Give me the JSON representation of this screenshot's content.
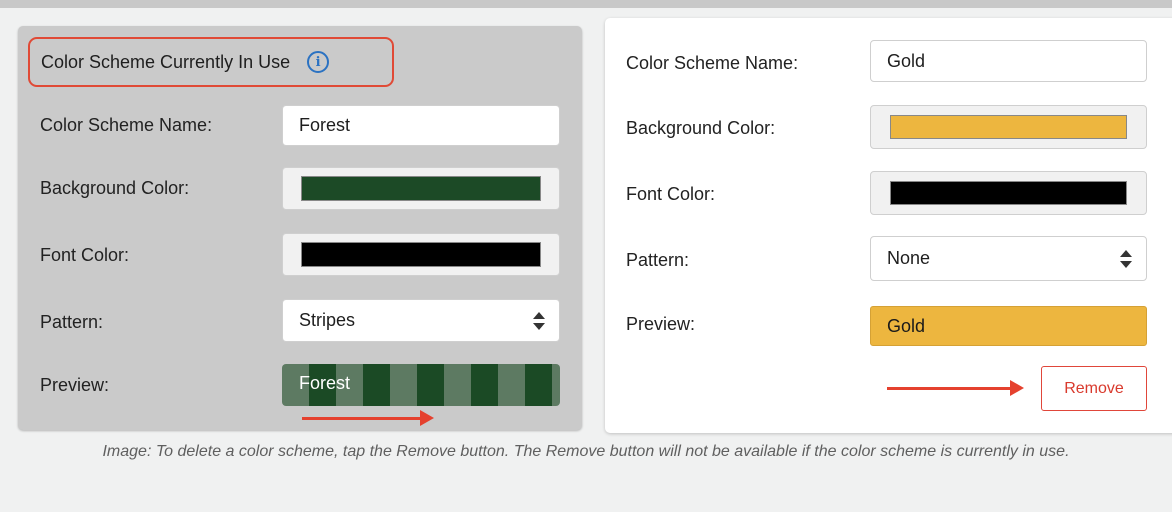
{
  "current_scheme": {
    "heading": "Color Scheme Currently In Use",
    "name_label": "Color Scheme Name:",
    "name_value": "Forest",
    "background_label": "Background Color:",
    "background_color": "#1c4a26",
    "font_label": "Font Color:",
    "font_color": "#000000",
    "pattern_label": "Pattern:",
    "pattern_value": "Stripes",
    "preview_label": "Preview:",
    "preview_text": "Forest"
  },
  "other_scheme": {
    "name_label": "Color Scheme Name:",
    "name_value": "Gold",
    "background_label": "Background Color:",
    "background_color": "#edb63f",
    "font_label": "Font Color:",
    "font_color": "#000000",
    "pattern_label": "Pattern:",
    "pattern_value": "None",
    "preview_label": "Preview:",
    "preview_text": "Gold",
    "remove_label": "Remove"
  },
  "caption": "Image: To delete a color scheme, tap the Remove button. The Remove button will not be available if the color scheme is currently in use.",
  "colors": {
    "annotation_red": "#e5412e",
    "info_blue": "#2b72c2"
  }
}
